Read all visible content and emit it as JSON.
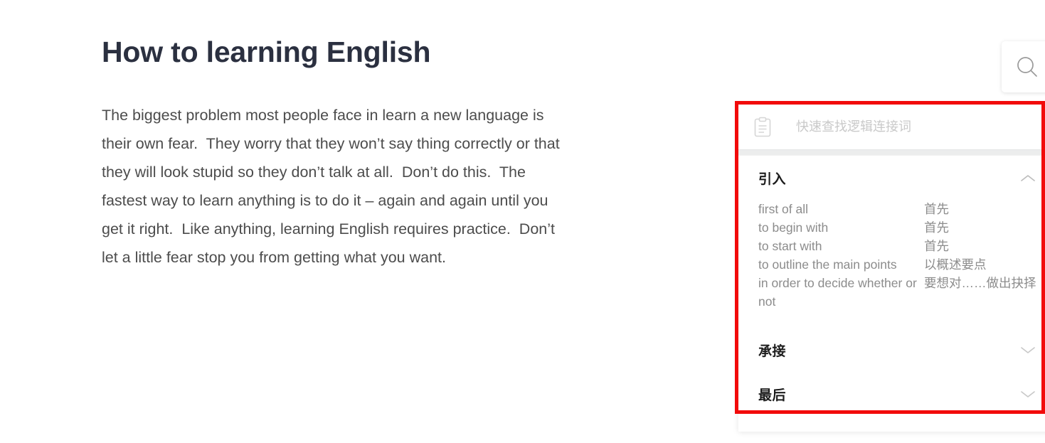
{
  "document": {
    "title": "How to learning English",
    "paragraph_lines": [
      "The biggest problem most people face in learn a new language is",
      "their own fear.  They worry that they won’t say thing correctly or that",
      "they will look stupid so they don’t talk at all.  Don’t do this.  The",
      "fastest way to learn anything is to do it – again and again until you",
      "get it right.  Like anything, learning English requires practice.  Don’t",
      "let a little fear stop you from getting what you want."
    ]
  },
  "search_button": {
    "icon": "search-icon"
  },
  "connector_panel": {
    "search": {
      "icon": "clipboard-icon",
      "placeholder": "快速查找逻辑连接词",
      "value": ""
    },
    "sections": [
      {
        "title": "引入",
        "expanded": true,
        "chevron": "chevron-up-icon",
        "entries": [
          {
            "en": "first of all",
            "zh": "首先"
          },
          {
            "en": "to begin with",
            "zh": "首先"
          },
          {
            "en": "to start with",
            "zh": "首先"
          },
          {
            "en": "to outline the main points",
            "zh": "以概述要点"
          },
          {
            "en": "in order to decide whether or not",
            "zh": "要想对……做出抉择"
          }
        ]
      },
      {
        "title": "承接",
        "expanded": false,
        "chevron": "chevron-down-icon",
        "entries": []
      },
      {
        "title": "最后",
        "expanded": false,
        "chevron": "chevron-down-icon",
        "entries": []
      }
    ]
  },
  "highlight": {
    "color": "#f20a0a"
  }
}
